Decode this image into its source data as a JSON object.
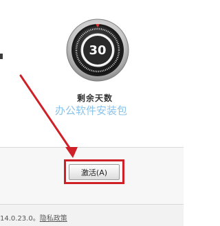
{
  "gauge": {
    "days_value": "30"
  },
  "labels": {
    "remaining_days": "剩余天数",
    "watermark": "办公软件安装包"
  },
  "button": {
    "activate_label": "激活(A)"
  },
  "footer": {
    "version": "14.0.23.0",
    "separator": "。",
    "privacy_link": "隐私政策"
  },
  "colors": {
    "highlight": "#cf2027",
    "watermark": "#8bc3ea"
  }
}
